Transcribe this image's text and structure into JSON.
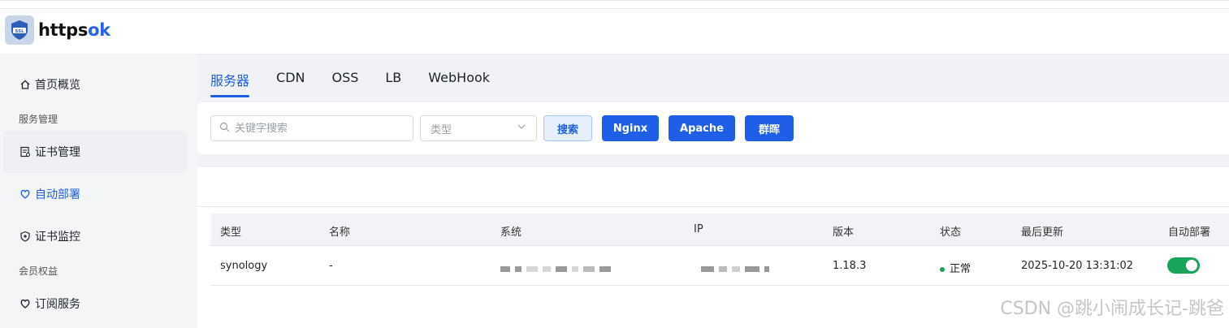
{
  "header": {
    "logo_icon": "ssl-shield-icon",
    "logo_main": "https",
    "logo_accent": "ok",
    "logo_badge": "SSL"
  },
  "sidebar": {
    "items": [
      {
        "label": "首页概览",
        "icon": "home-icon"
      },
      {
        "label": "证书管理",
        "icon": "certificate-icon"
      },
      {
        "label": "自动部署",
        "icon": "deploy-icon"
      },
      {
        "label": "证书监控",
        "icon": "shield-icon"
      },
      {
        "label": "订阅服务",
        "icon": "heart-icon"
      }
    ],
    "groups": [
      "服务管理",
      "会员权益"
    ]
  },
  "tabs": [
    "服务器",
    "CDN",
    "OSS",
    "LB",
    "WebHook"
  ],
  "filters": {
    "search_placeholder": "关键字搜索",
    "type_placeholder": "类型",
    "search_button": "搜索",
    "buttons": [
      "Nginx",
      "Apache",
      "群晖"
    ]
  },
  "table": {
    "columns": [
      "类型",
      "名称",
      "系统",
      "IP",
      "版本",
      "状态",
      "最后更新",
      "自动部署"
    ],
    "rows": [
      {
        "type": "synology",
        "name": "-",
        "version": "1.18.3",
        "status": "正常",
        "updated": "2025-10-20 13:31:02",
        "auto_deploy": true
      }
    ]
  },
  "colors": {
    "accent": "#1d5fe0",
    "success": "#1aa35a"
  },
  "watermark": "CSDN @跳小闹成长记-跳爸"
}
